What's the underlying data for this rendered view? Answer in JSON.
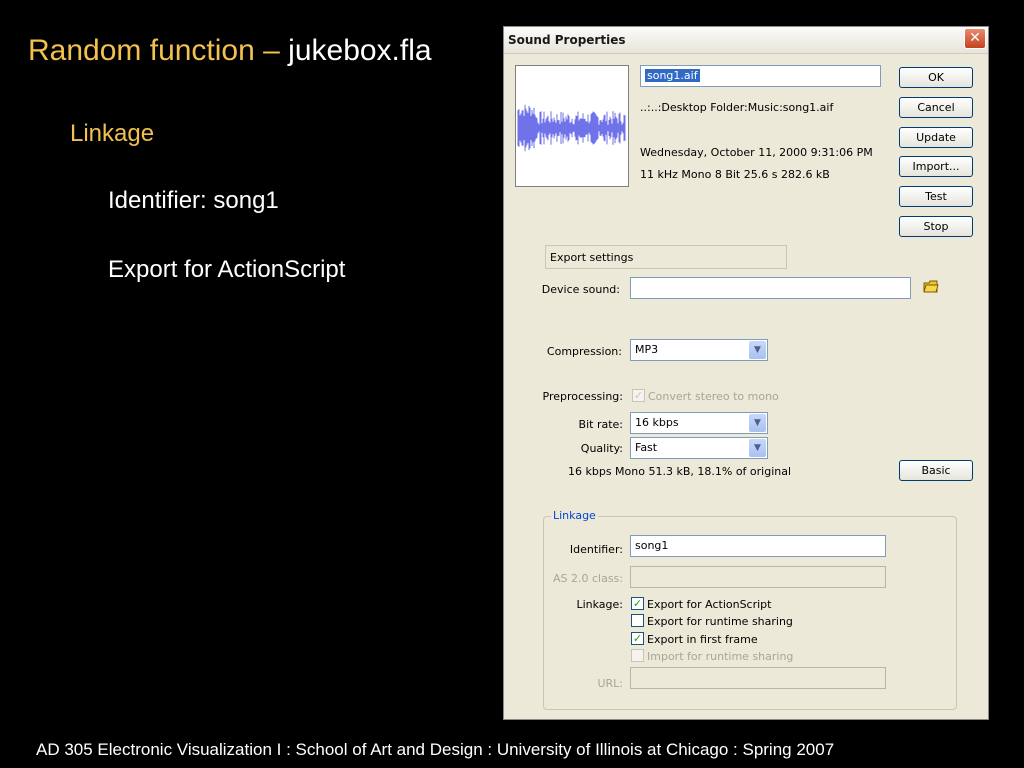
{
  "slide": {
    "title_prefix": "Random function – ",
    "title_file": "jukebox.fla",
    "subheading": "Linkage",
    "bullet1": "Identifier:  song1",
    "bullet2": "Export for ActionScript",
    "footer": "AD 305  Electronic Visualization I  :  School of Art and Design :  University of Illinois at Chicago :  Spring 2007"
  },
  "dialog": {
    "title": "Sound Properties",
    "close_glyph": "✕",
    "filename": "song1.aif",
    "path": "..:..:Desktop Folder:Music:song1.aif",
    "date": "Wednesday, October 11, 2000  9:31:06 PM",
    "format": "11 kHz Mono 8 Bit 25.6 s 282.6 kB",
    "buttons": {
      "ok": "OK",
      "cancel": "Cancel",
      "update": "Update",
      "import": "Import...",
      "test": "Test",
      "stop": "Stop",
      "basic": "Basic"
    },
    "export_settings": {
      "heading": "Export settings",
      "device_sound_label": "Device sound:",
      "device_sound_value": "",
      "compression_label": "Compression:",
      "compression_value": "MP3",
      "preprocessing_label": "Preprocessing:",
      "preprocessing_option": "Convert stereo to mono",
      "preprocessing_checked": true,
      "bitrate_label": "Bit rate:",
      "bitrate_value": "16 kbps",
      "quality_label": "Quality:",
      "quality_value": "Fast",
      "summary": "16 kbps  Mono 51.3 kB, 18.1% of original"
    },
    "linkage": {
      "legend": "Linkage",
      "identifier_label": "Identifier:",
      "identifier_value": "song1",
      "as2_label": "AS 2.0 class:",
      "as2_value": "",
      "linkage_label": "Linkage:",
      "options": [
        {
          "label": "Export for ActionScript",
          "checked": true,
          "enabled": true
        },
        {
          "label": "Export for runtime sharing",
          "checked": false,
          "enabled": true
        },
        {
          "label": "Export in first frame",
          "checked": true,
          "enabled": true
        },
        {
          "label": "Import for runtime sharing",
          "checked": false,
          "enabled": false
        }
      ],
      "url_label": "URL:",
      "url_value": ""
    },
    "colors": {
      "accent": "#316ac5",
      "waveform": "#6f72e8",
      "close": "#c4421f"
    }
  }
}
